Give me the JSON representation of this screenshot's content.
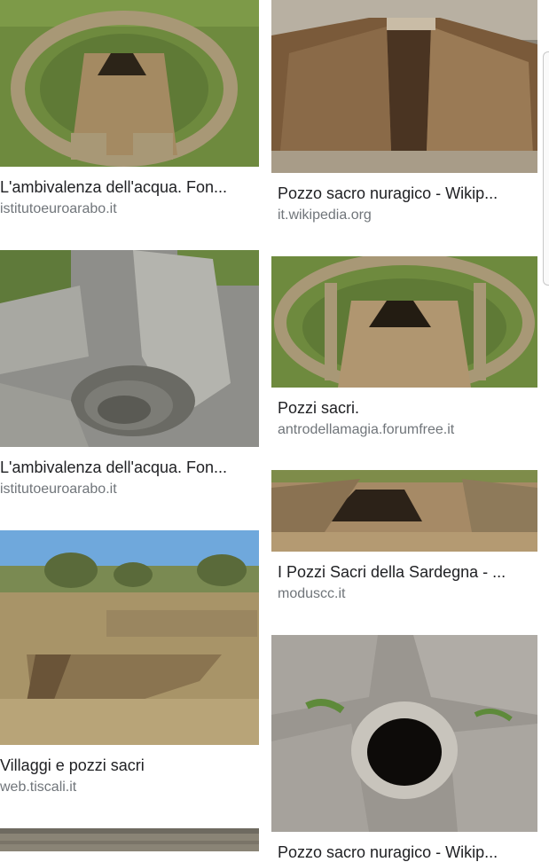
{
  "results": [
    {
      "title": "L'ambivalenza dell'acqua. Fon...",
      "source": "istitutoeuroarabo.it"
    },
    {
      "title": "Pozzo sacro nuragico - Wikip...",
      "source": "it.wikipedia.org"
    },
    {
      "title": "L'ambivalenza dell'acqua. Fon...",
      "source": "istitutoeuroarabo.it"
    },
    {
      "title": "Pozzi sacri.",
      "source": "antrodellamagia.forumfree.it"
    },
    {
      "title": "I Pozzi Sacri della Sardegna - ...",
      "source": "moduscc.it"
    },
    {
      "title": "Villaggi e pozzi sacri",
      "source": "web.tiscali.it"
    },
    {
      "title": "Pozzo sacro nuragico - Wikip...",
      "source": ""
    }
  ],
  "colors": {
    "title": "#202124",
    "source": "#70757a",
    "background": "#ffffff"
  }
}
